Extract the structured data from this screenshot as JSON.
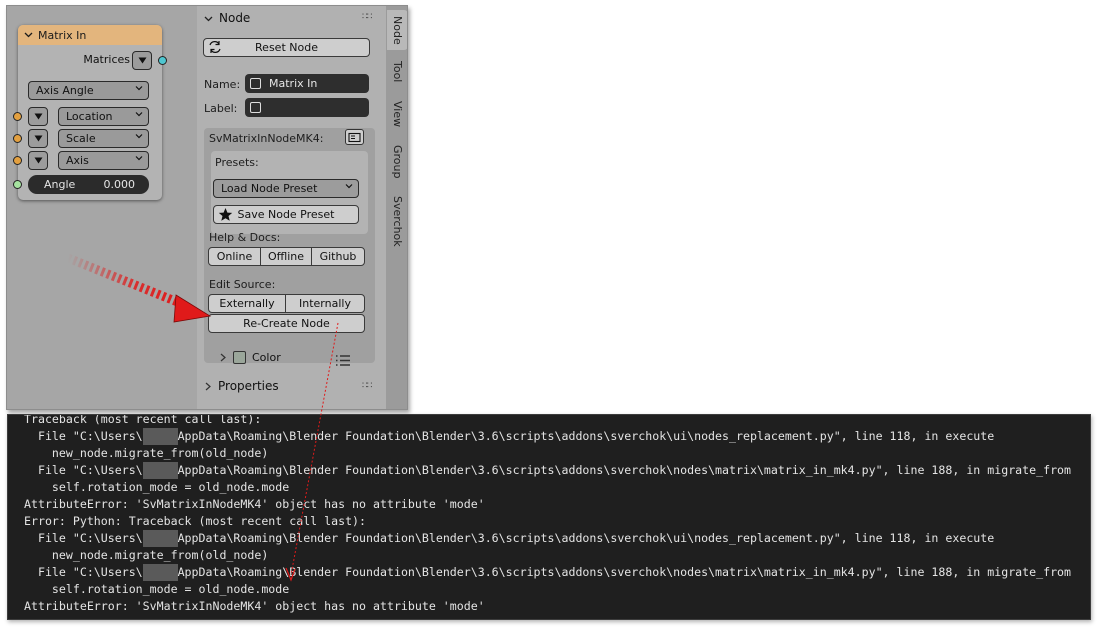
{
  "node_card": {
    "title": "Matrix In",
    "output_label": "Matrices",
    "mode_select": "Axis Angle",
    "inputs": [
      {
        "label": "Location"
      },
      {
        "label": "Scale"
      },
      {
        "label": "Axis"
      }
    ],
    "angle_label": "Angle",
    "angle_value": "0.000"
  },
  "npanel": {
    "section_title": "Node",
    "reset_button": "Reset Node",
    "name_label": "Name:",
    "name_value": "Matrix In",
    "label_label": "Label:",
    "label_value": "",
    "node_class": "SvMatrixInNodeMK4:",
    "presets_label": "Presets:",
    "load_preset": "Load Node Preset",
    "save_preset": "Save Node Preset",
    "help_label": "Help & Docs:",
    "help_buttons": [
      "Online",
      "Offline",
      "Github"
    ],
    "edit_label": "Edit Source:",
    "edit_buttons": [
      "Externally",
      "Internally"
    ],
    "recreate_button": "Re-Create Node",
    "color_label": "Color",
    "properties_label": "Properties"
  },
  "tabs": [
    "Node",
    "Tool",
    "View",
    "Group",
    "Sverchok"
  ],
  "console": {
    "lines": [
      {
        "a": "Traceback (most recent call last):"
      },
      {
        "a": "  File \"C:\\Users\\",
        "r": "XXXXX",
        "b": "AppData\\Roaming\\Blender Foundation\\Blender\\3.6\\scripts\\addons\\sverchok\\ui\\nodes_replacement.py\", line 118, in execute"
      },
      {
        "a": "    new_node.migrate_from(old_node)"
      },
      {
        "a": "  File \"C:\\Users\\",
        "r": "XXXXX",
        "b": "AppData\\Roaming\\Blender Foundation\\Blender\\3.6\\scripts\\addons\\sverchok\\nodes\\matrix\\matrix_in_mk4.py\", line 188, in migrate_from"
      },
      {
        "a": "    self.rotation_mode = old_node.mode"
      },
      {
        "a": "AttributeError: 'SvMatrixInNodeMK4' object has no attribute 'mode'"
      },
      {
        "a": "Error: Python: Traceback (most recent call last):"
      },
      {
        "a": "  File \"C:\\Users\\",
        "r": "XXXXX",
        "b": "AppData\\Roaming\\Blender Foundation\\Blender\\3.6\\scripts\\addons\\sverchok\\ui\\nodes_replacement.py\", line 118, in execute"
      },
      {
        "a": "    new_node.migrate_from(old_node)"
      },
      {
        "a": "  File \"C:\\Users\\",
        "r": "XXXXX",
        "b": "AppData\\Roaming\\Blender Foundation\\Blender\\3.6\\scripts\\addons\\sverchok\\nodes\\matrix\\matrix_in_mk4.py\", line 188, in migrate_from"
      },
      {
        "a": "    self.rotation_mode = old_node.mode"
      },
      {
        "a": "AttributeError: 'SvMatrixInNodeMK4' object has no attribute 'mode'"
      }
    ]
  },
  "colors": {
    "node_header": "#e3b57d",
    "socket_orange": "#e3a040",
    "socket_cyan": "#4fc6d0",
    "socket_green": "#a6e3a0",
    "arrow_red": "#e01a1a",
    "console_bg": "#1f1f1f"
  },
  "icons": [
    "chevron-down-icon",
    "refresh-icon",
    "node-icon",
    "star-icon",
    "list-icon",
    "socket-icon"
  ]
}
